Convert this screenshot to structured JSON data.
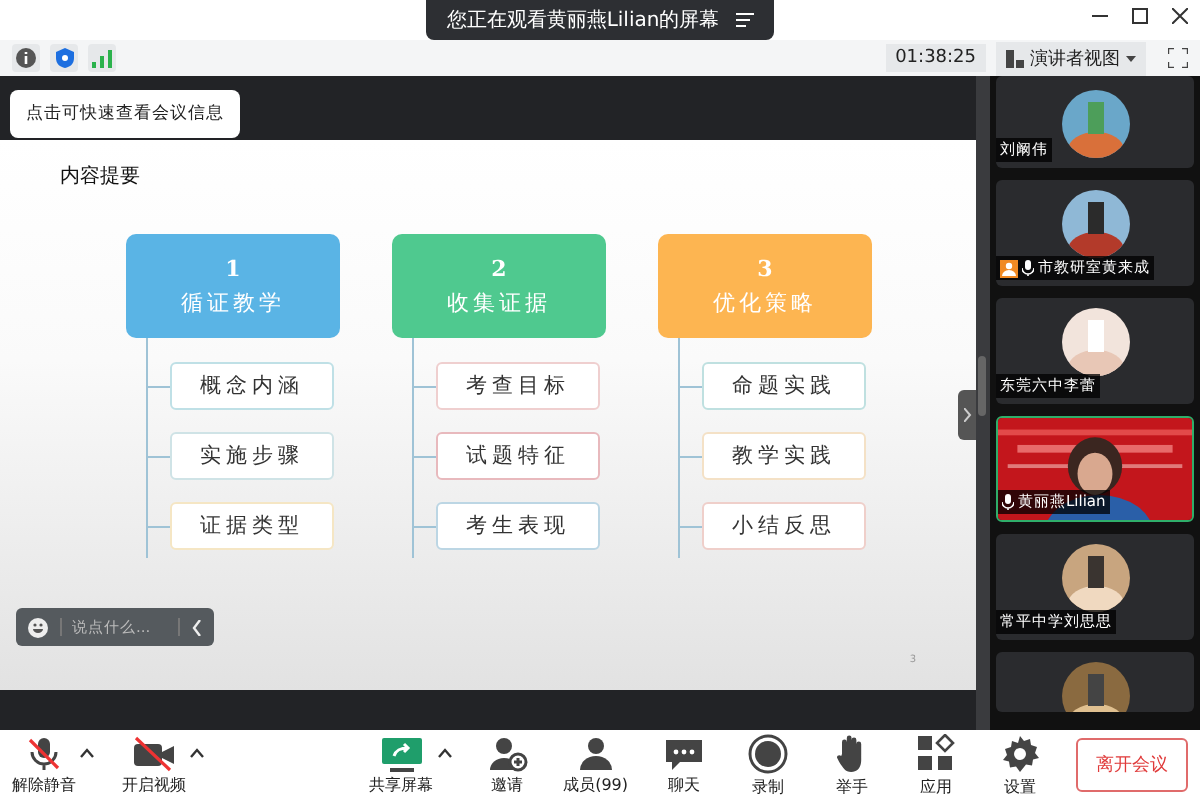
{
  "window": {
    "banner": "您正在观看黄丽燕Lilian的屏幕"
  },
  "toolbar": {
    "timer": "01:38:25",
    "view_button": "演讲者视图"
  },
  "tooltip": "点击可快速查看会议信息",
  "slide": {
    "title": "内容提要",
    "page": "3",
    "columns": [
      {
        "number": "1",
        "heading": "循证教学",
        "color": "#5ab4e5",
        "items": [
          {
            "label": "概念内涵",
            "color": "#bfe0e6"
          },
          {
            "label": "实施步骤",
            "color": "#cfe3e6"
          },
          {
            "label": "证据类型",
            "color": "#f5e6c4"
          }
        ]
      },
      {
        "number": "2",
        "heading": "收集证据",
        "color": "#4fc98f",
        "items": [
          {
            "label": "考查目标",
            "color": "#efcfcf"
          },
          {
            "label": "试题特征",
            "color": "#e8b9bd"
          },
          {
            "label": "考生表现",
            "color": "#bcd6e4"
          }
        ]
      },
      {
        "number": "3",
        "heading": "优化策略",
        "color": "#fdb551",
        "items": [
          {
            "label": "命题实践",
            "color": "#bfe0e0"
          },
          {
            "label": "教学实践",
            "color": "#f4e1c6"
          },
          {
            "label": "小结反思",
            "color": "#efcfca"
          }
        ]
      }
    ]
  },
  "chat_input": {
    "placeholder": "说点什么..."
  },
  "participants": [
    {
      "name": "刘阚伟",
      "mic": false,
      "badge": false,
      "speaking": false
    },
    {
      "name": "市教研室黄来成",
      "mic": true,
      "badge": true,
      "speaking": false
    },
    {
      "name": "东莞六中李蕾",
      "mic": false,
      "badge": false,
      "speaking": false
    },
    {
      "name": "黄丽燕Lilian",
      "mic": true,
      "badge": false,
      "speaking": true
    },
    {
      "name": "常平中学刘思思",
      "mic": false,
      "badge": false,
      "speaking": false
    },
    {
      "speaking": false
    }
  ],
  "bottom_bar": {
    "items": [
      {
        "label": "解除静音",
        "caret": true
      },
      {
        "label": "开启视频",
        "caret": true
      },
      {
        "label": "共享屏幕",
        "caret": true
      },
      {
        "label": "邀请",
        "caret": false
      },
      {
        "label": "成员(99)",
        "caret": false
      },
      {
        "label": "聊天",
        "caret": false
      },
      {
        "label": "录制",
        "caret": false
      },
      {
        "label": "举手",
        "caret": false
      },
      {
        "label": "应用",
        "caret": false
      },
      {
        "label": "设置",
        "caret": false
      }
    ],
    "leave_button": "离开会议"
  }
}
